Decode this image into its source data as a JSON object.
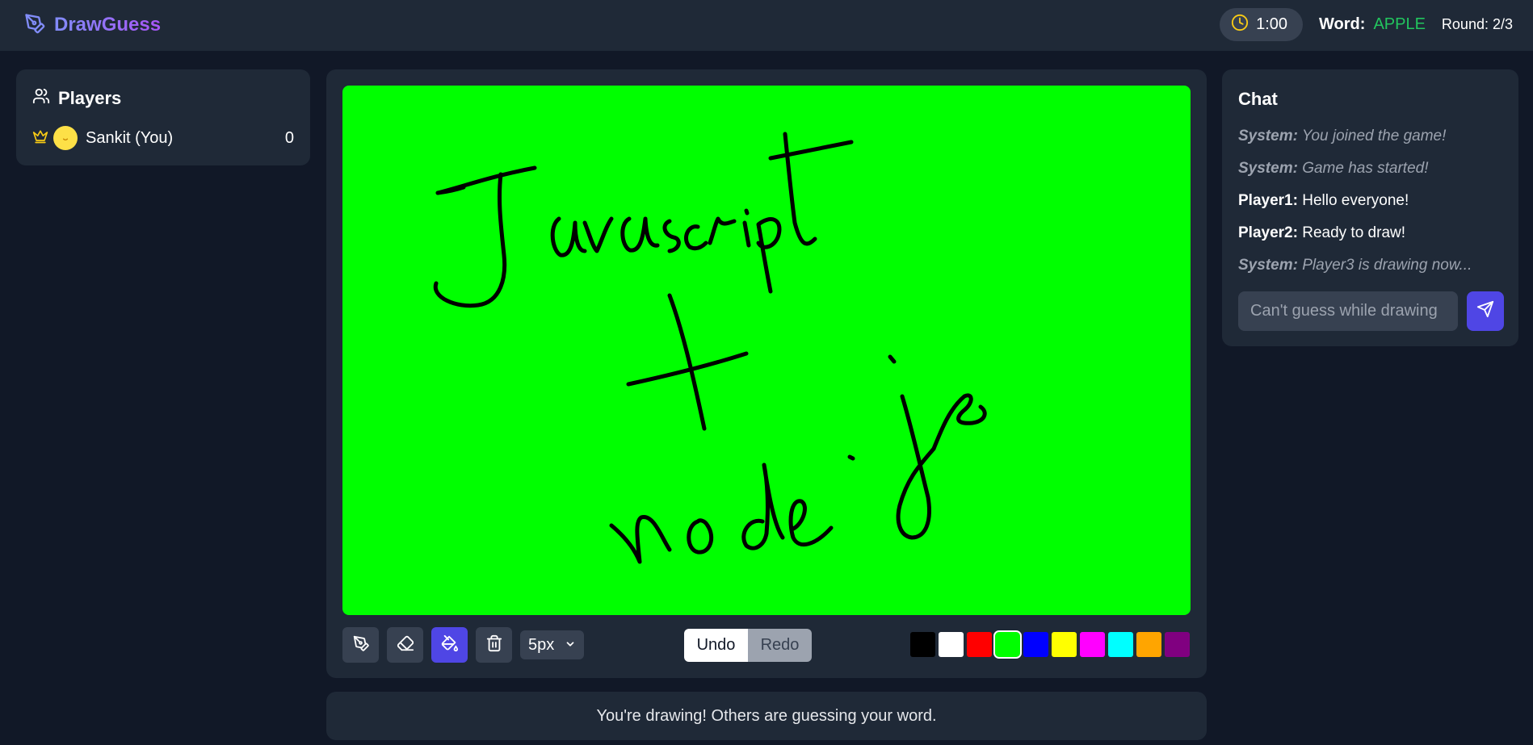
{
  "header": {
    "brand": "DrawGuess",
    "timer": "1:00",
    "word_label": "Word:",
    "word_value": "APPLE",
    "round": "Round: 2/3"
  },
  "players": {
    "title": "Players",
    "list": [
      {
        "name": "Sankit (You)",
        "score": "0",
        "is_host": true
      }
    ]
  },
  "toolbar": {
    "brush_size": "5px",
    "undo_label": "Undo",
    "redo_label": "Redo",
    "active_tool": "fill",
    "selected_color": "#00ff00",
    "colors": [
      "#000000",
      "#ffffff",
      "#ff0000",
      "#00ff00",
      "#0000ff",
      "#ffff00",
      "#ff00ff",
      "#00ffff",
      "#ffa500",
      "#800080"
    ]
  },
  "canvas": {
    "background_color": "#00ff00",
    "stroke_color": "#000000",
    "drawing_text": "Javascript + node.js"
  },
  "status": {
    "message": "You're drawing! Others are guessing your word."
  },
  "chat": {
    "title": "Chat",
    "messages": [
      {
        "sender": "System:",
        "text": "You joined the game!",
        "type": "system"
      },
      {
        "sender": "System:",
        "text": "Game has started!",
        "type": "system"
      },
      {
        "sender": "Player1:",
        "text": "Hello everyone!",
        "type": "user"
      },
      {
        "sender": "Player2:",
        "text": "Ready to draw!",
        "type": "user"
      },
      {
        "sender": "System:",
        "text": "Player3 is drawing now...",
        "type": "system"
      }
    ],
    "input_placeholder": "Can't guess while drawing"
  }
}
